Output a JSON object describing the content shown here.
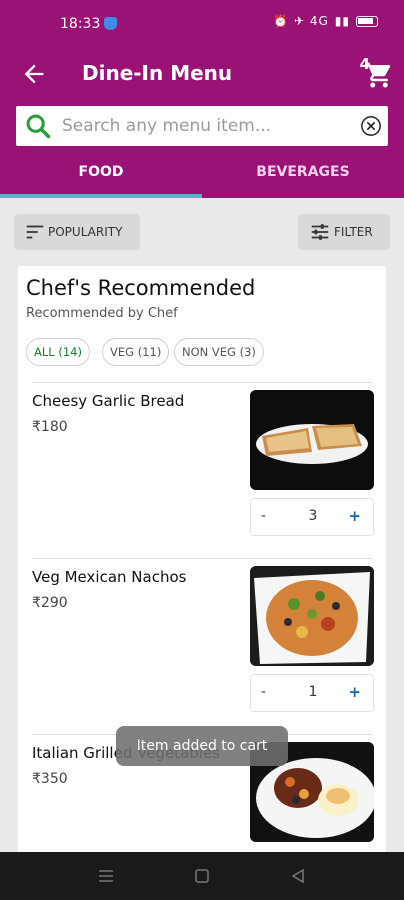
{
  "status": {
    "time": "18:33",
    "indicators": "⏰ ✈ 4G"
  },
  "header": {
    "title": "Dine-In Menu",
    "cart_count": "4"
  },
  "search": {
    "placeholder": "Search any menu item..."
  },
  "tabs": [
    {
      "label": "FOOD",
      "active": true
    },
    {
      "label": "BEVERAGES",
      "active": false
    }
  ],
  "toolbar": {
    "sort_label": "POPULARITY",
    "filter_label": "FILTER"
  },
  "section": {
    "title": "Chef's Recommended",
    "subtitle": "Recommended by Chef",
    "chips": [
      {
        "label": "ALL (14)",
        "selected": true
      },
      {
        "label": "VEG (11)",
        "selected": false
      },
      {
        "label": "NON VEG (3)",
        "selected": false
      }
    ]
  },
  "items": [
    {
      "name": "Cheesy Garlic Bread",
      "price": "₹180",
      "qty": "3",
      "minus": "-",
      "plus": "+"
    },
    {
      "name": "Veg Mexican Nachos",
      "price": "₹290",
      "qty": "1",
      "minus": "-",
      "plus": "+"
    },
    {
      "name": "Italian Grilled Vegetables",
      "price": "₹350"
    }
  ],
  "toast": "Item added to cart",
  "colors": {
    "primary": "#9a1275",
    "tab_indicator": "#5ab3c8",
    "accent_green": "#1a7a2d",
    "plus_blue": "#1565a8"
  }
}
